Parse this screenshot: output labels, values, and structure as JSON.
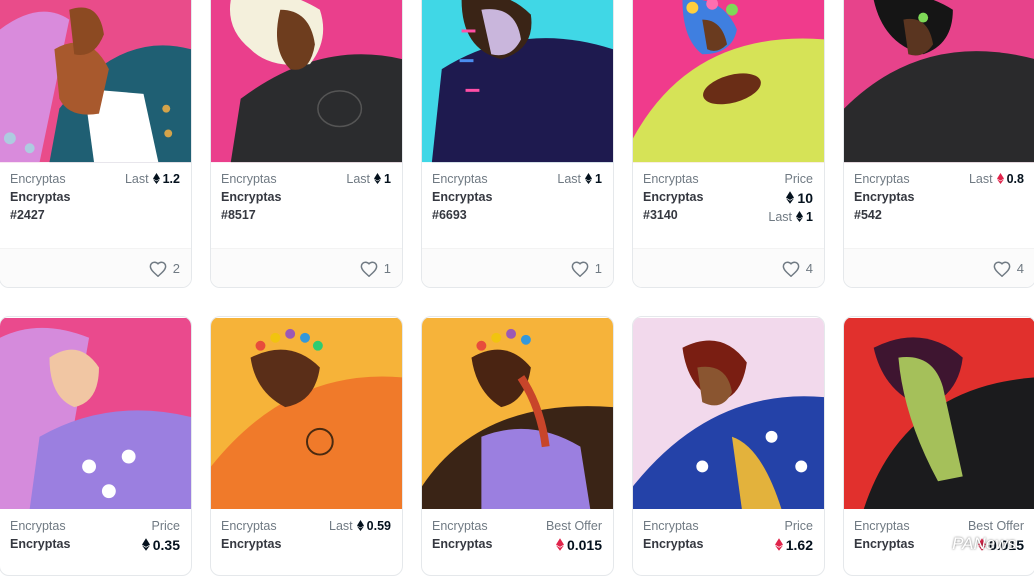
{
  "cards_row1": [
    {
      "collection": "Encryptas",
      "name": "Encryptas",
      "number": "#2427",
      "price_label": "Last",
      "price": "1.2",
      "likes": "2",
      "bg": "#e94c8a"
    },
    {
      "collection": "Encryptas",
      "name": "Encryptas",
      "number": "#8517",
      "price_label": "Last",
      "price": "1",
      "likes": "1",
      "bg": "#ea3f8c"
    },
    {
      "collection": "Encryptas",
      "name": "Encryptas",
      "number": "#6693",
      "price_label": "Last",
      "price": "1",
      "likes": "1",
      "bg": "#40d7e6"
    },
    {
      "collection": "Encryptas",
      "name": "Encryptas",
      "number": "#3140",
      "price_label": "Price",
      "price": "10",
      "last_label": "Last",
      "last": "1",
      "likes": "4",
      "bg": "#f03b8c"
    },
    {
      "collection": "Encryptas",
      "name": "Encryptas",
      "number": "#542",
      "price_label": "Last",
      "price": "0.8",
      "likes": "4",
      "bg": "#e7438b"
    }
  ],
  "cards_row2": [
    {
      "collection": "Encryptas",
      "name": "Encryptas",
      "price_label": "Price",
      "price": "0.35",
      "bg": "#ea4a8d"
    },
    {
      "collection": "Encryptas",
      "name": "Encryptas",
      "price_label": "Last",
      "price": "0.59",
      "bg": "#f6b339"
    },
    {
      "collection": "Encryptas",
      "name": "Encryptas",
      "price_label": "Best Offer",
      "price": "0.015",
      "bg": "#f6b33a"
    },
    {
      "collection": "Encryptas",
      "name": "Encryptas",
      "price_label": "Price",
      "price": "1.62",
      "bg": "#f2d9ec"
    },
    {
      "collection": "Encryptas",
      "name": "Encryptas",
      "price_label": "Best Offer",
      "price": "0.015",
      "bg": "#e1302d"
    }
  ],
  "watermark": "PANews"
}
